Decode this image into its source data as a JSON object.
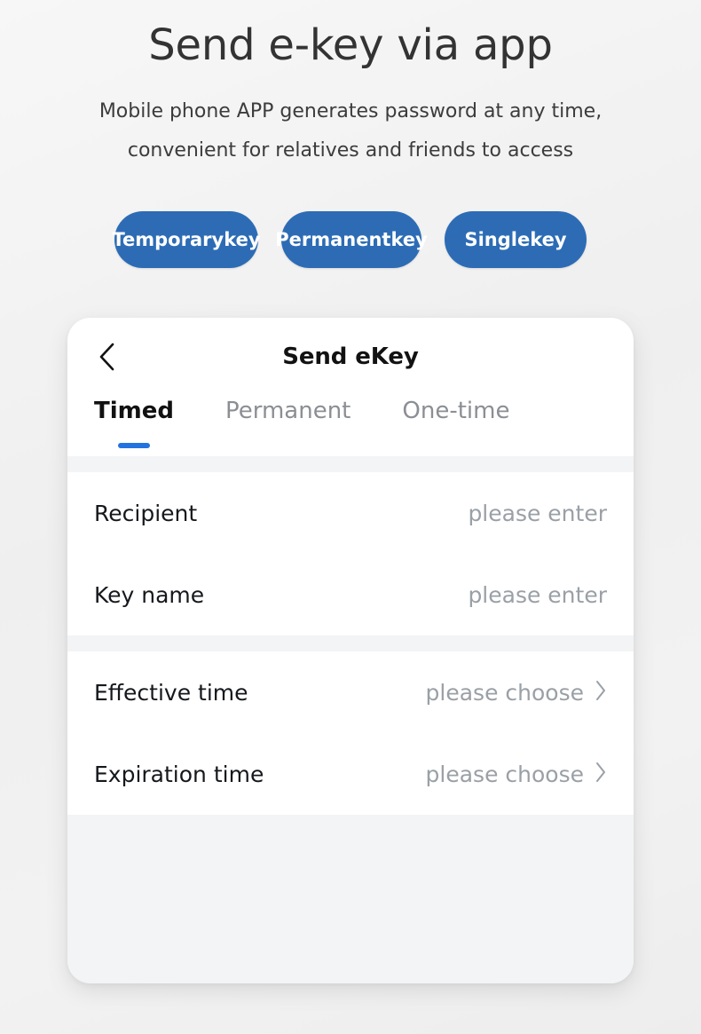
{
  "hero": {
    "title": "Send e-key via app",
    "subtitle_line1": "Mobile phone APP generates password at any time,",
    "subtitle_line2": "convenient for relatives and friends to access"
  },
  "pills": [
    {
      "line1": "Temporary",
      "line2": "key"
    },
    {
      "line1": "Permanent",
      "line2": "key"
    },
    {
      "line1": "Single",
      "line2": "key"
    }
  ],
  "phone": {
    "nav": {
      "back_icon": "chevron-left-icon",
      "title": "Send eKey"
    },
    "tabs": [
      {
        "label": "Timed",
        "active": true
      },
      {
        "label": "Permanent",
        "active": false
      },
      {
        "label": "One-time",
        "active": false
      }
    ],
    "groups": [
      {
        "rows": [
          {
            "label": "Recipient",
            "value": "please enter",
            "chevron": false
          },
          {
            "label": "Key name",
            "value": "please enter",
            "chevron": false
          }
        ]
      },
      {
        "rows": [
          {
            "label": "Effective time",
            "value": "please choose",
            "chevron": true
          },
          {
            "label": "Expiration time",
            "value": "please choose",
            "chevron": true
          }
        ]
      }
    ]
  },
  "colors": {
    "pill_blue": "#2d6cb5",
    "tab_accent_blue": "#2273e0",
    "heading_gray": "#333333",
    "placeholder_gray": "#9aa0a6",
    "card_bg": "#f3f4f5",
    "page_bg": "#efefef"
  }
}
